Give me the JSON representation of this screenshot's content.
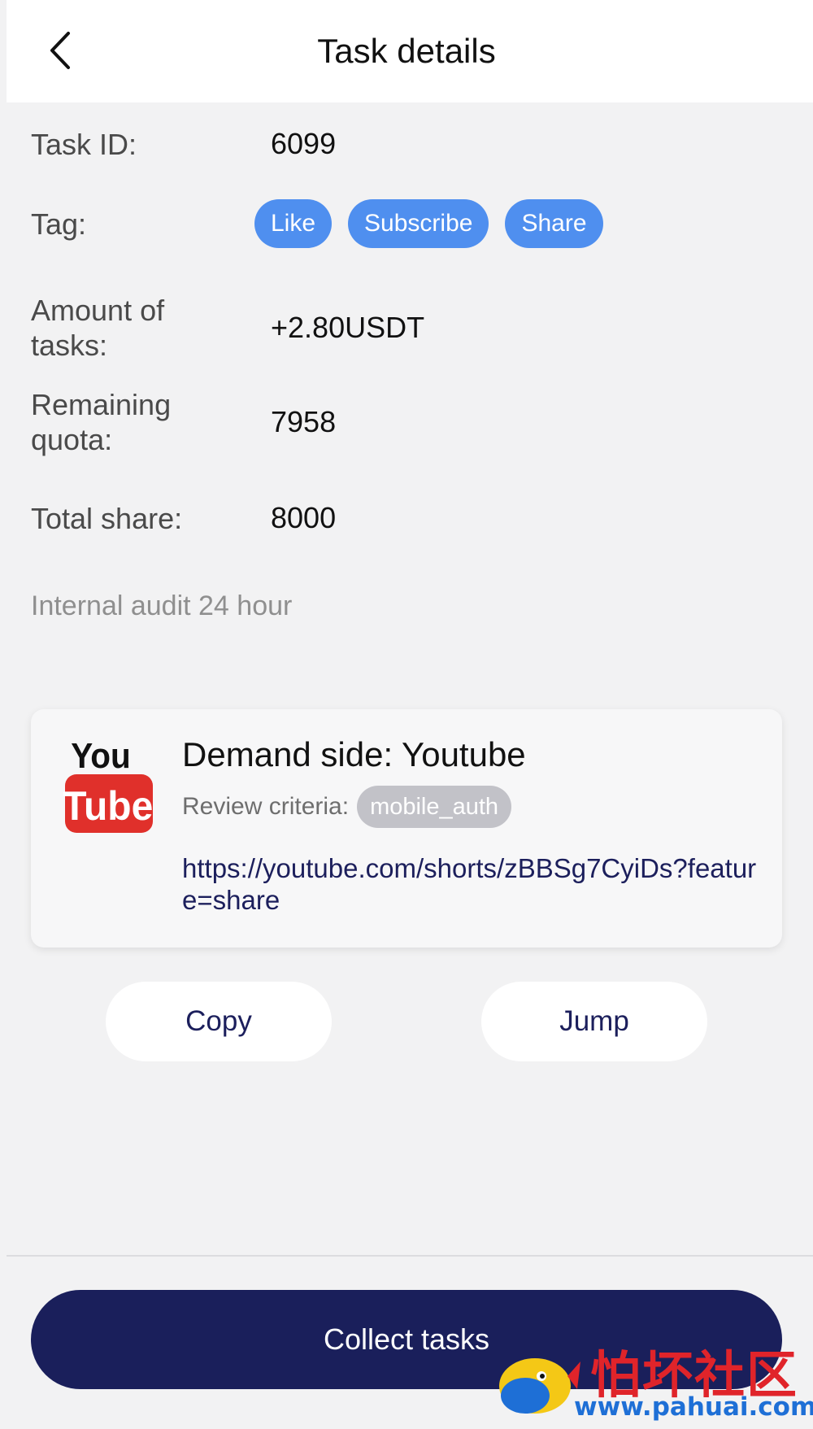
{
  "header": {
    "title": "Task details",
    "back_icon": "chevron-left-icon"
  },
  "info": {
    "task_id": {
      "label": "Task ID:",
      "value": "6099"
    },
    "tag": {
      "label": "Tag:",
      "items": [
        "Like",
        "Subscribe",
        "Share"
      ]
    },
    "amount": {
      "label": "Amount of tasks:",
      "value": "+2.80USDT"
    },
    "remaining": {
      "label": "Remaining quota:",
      "value": "7958"
    },
    "total_share": {
      "label": "Total share:",
      "value": "8000"
    },
    "audit_note": "Internal audit 24 hour"
  },
  "card": {
    "logo": {
      "line1": "You",
      "line2": "Tube"
    },
    "demand_side": "Demand side: Youtube",
    "criteria_label": "Review criteria:",
    "criteria_badge": "mobile_auth",
    "link": "https://youtube.com/shorts/zBBSg7CyiDs?feature=share"
  },
  "actions": {
    "copy_label": "Copy",
    "jump_label": "Jump",
    "collect_label": "Collect tasks"
  },
  "watermark": {
    "chinese": "怕坏社区",
    "url": "www.pahuai.com"
  },
  "colors": {
    "tag_blue": "#4f8fef",
    "primary_navy": "#1a1f5b",
    "badge_gray": "#c2c2c8",
    "youtube_red": "#e0302b",
    "background": "#f2f2f3"
  }
}
